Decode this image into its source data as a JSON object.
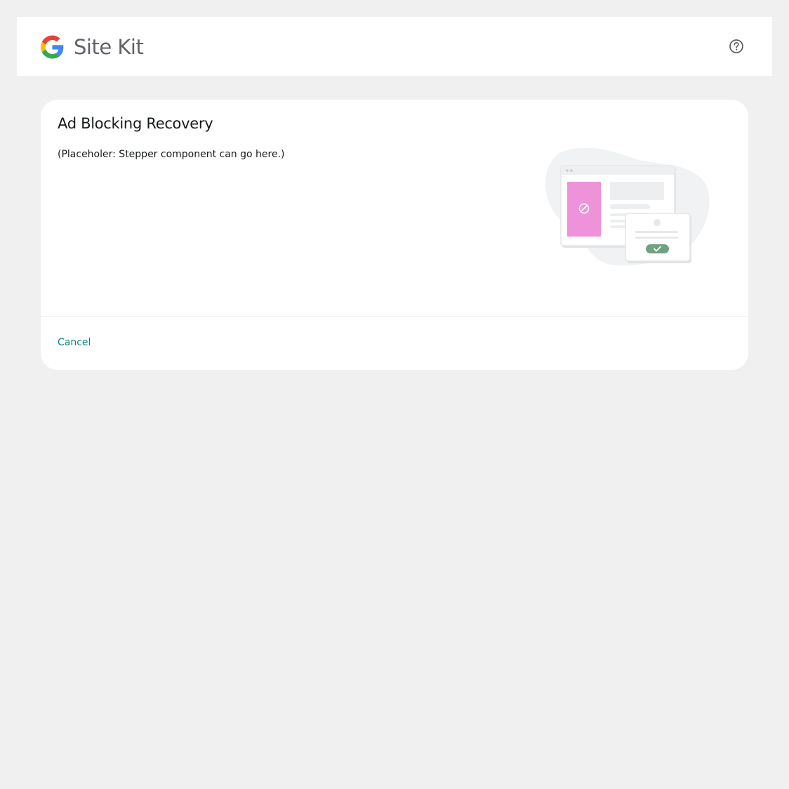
{
  "header": {
    "logo_word_site": "Site",
    "logo_word_kit": "Kit",
    "help_icon": "help-circle-icon"
  },
  "card": {
    "title": "Ad Blocking Recovery",
    "description": "(Placeholer: Stepper component can go here.)",
    "illustration_icons": [
      "block-icon",
      "check-icon"
    ],
    "cancel_label": "Cancel"
  },
  "colors": {
    "page_background": "#f0f0f1",
    "surface": "#ffffff",
    "text": "#161b18",
    "logo_text": "#5f6368",
    "link": "#108080",
    "illustration_ad": "#ee92da",
    "illustration_check": "#6fa27f"
  }
}
